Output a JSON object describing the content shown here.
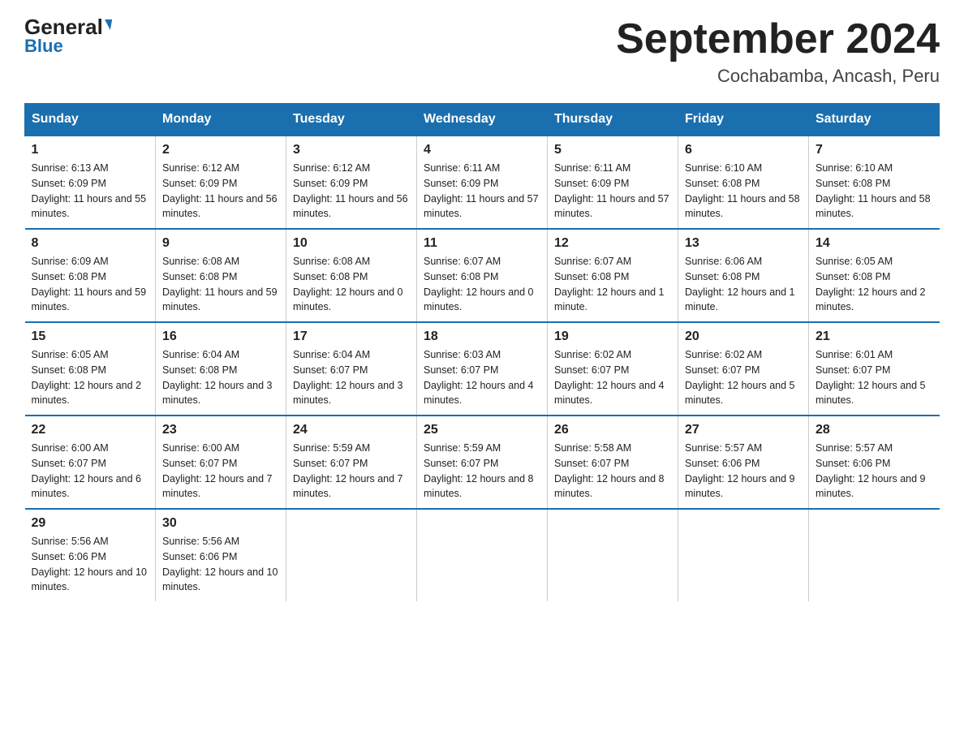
{
  "header": {
    "logo_text": "General",
    "logo_blue": "Blue",
    "month_year": "September 2024",
    "location": "Cochabamba, Ancash, Peru"
  },
  "days_of_week": [
    "Sunday",
    "Monday",
    "Tuesday",
    "Wednesday",
    "Thursday",
    "Friday",
    "Saturday"
  ],
  "weeks": [
    [
      {
        "day": "1",
        "sunrise": "6:13 AM",
        "sunset": "6:09 PM",
        "daylight": "11 hours and 55 minutes."
      },
      {
        "day": "2",
        "sunrise": "6:12 AM",
        "sunset": "6:09 PM",
        "daylight": "11 hours and 56 minutes."
      },
      {
        "day": "3",
        "sunrise": "6:12 AM",
        "sunset": "6:09 PM",
        "daylight": "11 hours and 56 minutes."
      },
      {
        "day": "4",
        "sunrise": "6:11 AM",
        "sunset": "6:09 PM",
        "daylight": "11 hours and 57 minutes."
      },
      {
        "day": "5",
        "sunrise": "6:11 AM",
        "sunset": "6:09 PM",
        "daylight": "11 hours and 57 minutes."
      },
      {
        "day": "6",
        "sunrise": "6:10 AM",
        "sunset": "6:08 PM",
        "daylight": "11 hours and 58 minutes."
      },
      {
        "day": "7",
        "sunrise": "6:10 AM",
        "sunset": "6:08 PM",
        "daylight": "11 hours and 58 minutes."
      }
    ],
    [
      {
        "day": "8",
        "sunrise": "6:09 AM",
        "sunset": "6:08 PM",
        "daylight": "11 hours and 59 minutes."
      },
      {
        "day": "9",
        "sunrise": "6:08 AM",
        "sunset": "6:08 PM",
        "daylight": "11 hours and 59 minutes."
      },
      {
        "day": "10",
        "sunrise": "6:08 AM",
        "sunset": "6:08 PM",
        "daylight": "12 hours and 0 minutes."
      },
      {
        "day": "11",
        "sunrise": "6:07 AM",
        "sunset": "6:08 PM",
        "daylight": "12 hours and 0 minutes."
      },
      {
        "day": "12",
        "sunrise": "6:07 AM",
        "sunset": "6:08 PM",
        "daylight": "12 hours and 1 minute."
      },
      {
        "day": "13",
        "sunrise": "6:06 AM",
        "sunset": "6:08 PM",
        "daylight": "12 hours and 1 minute."
      },
      {
        "day": "14",
        "sunrise": "6:05 AM",
        "sunset": "6:08 PM",
        "daylight": "12 hours and 2 minutes."
      }
    ],
    [
      {
        "day": "15",
        "sunrise": "6:05 AM",
        "sunset": "6:08 PM",
        "daylight": "12 hours and 2 minutes."
      },
      {
        "day": "16",
        "sunrise": "6:04 AM",
        "sunset": "6:08 PM",
        "daylight": "12 hours and 3 minutes."
      },
      {
        "day": "17",
        "sunrise": "6:04 AM",
        "sunset": "6:07 PM",
        "daylight": "12 hours and 3 minutes."
      },
      {
        "day": "18",
        "sunrise": "6:03 AM",
        "sunset": "6:07 PM",
        "daylight": "12 hours and 4 minutes."
      },
      {
        "day": "19",
        "sunrise": "6:02 AM",
        "sunset": "6:07 PM",
        "daylight": "12 hours and 4 minutes."
      },
      {
        "day": "20",
        "sunrise": "6:02 AM",
        "sunset": "6:07 PM",
        "daylight": "12 hours and 5 minutes."
      },
      {
        "day": "21",
        "sunrise": "6:01 AM",
        "sunset": "6:07 PM",
        "daylight": "12 hours and 5 minutes."
      }
    ],
    [
      {
        "day": "22",
        "sunrise": "6:00 AM",
        "sunset": "6:07 PM",
        "daylight": "12 hours and 6 minutes."
      },
      {
        "day": "23",
        "sunrise": "6:00 AM",
        "sunset": "6:07 PM",
        "daylight": "12 hours and 7 minutes."
      },
      {
        "day": "24",
        "sunrise": "5:59 AM",
        "sunset": "6:07 PM",
        "daylight": "12 hours and 7 minutes."
      },
      {
        "day": "25",
        "sunrise": "5:59 AM",
        "sunset": "6:07 PM",
        "daylight": "12 hours and 8 minutes."
      },
      {
        "day": "26",
        "sunrise": "5:58 AM",
        "sunset": "6:07 PM",
        "daylight": "12 hours and 8 minutes."
      },
      {
        "day": "27",
        "sunrise": "5:57 AM",
        "sunset": "6:06 PM",
        "daylight": "12 hours and 9 minutes."
      },
      {
        "day": "28",
        "sunrise": "5:57 AM",
        "sunset": "6:06 PM",
        "daylight": "12 hours and 9 minutes."
      }
    ],
    [
      {
        "day": "29",
        "sunrise": "5:56 AM",
        "sunset": "6:06 PM",
        "daylight": "12 hours and 10 minutes."
      },
      {
        "day": "30",
        "sunrise": "5:56 AM",
        "sunset": "6:06 PM",
        "daylight": "12 hours and 10 minutes."
      },
      null,
      null,
      null,
      null,
      null
    ]
  ]
}
